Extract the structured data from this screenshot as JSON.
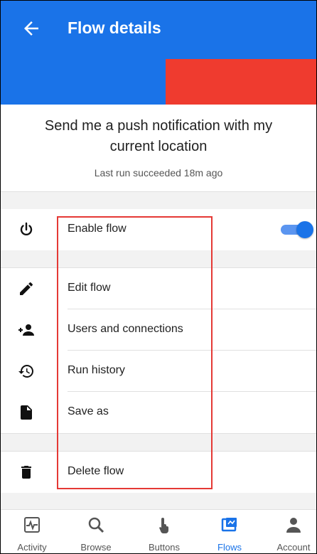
{
  "header": {
    "title": "Flow details",
    "back_icon": "arrow-left-icon"
  },
  "banner": {
    "colors": [
      "#1a73e8",
      "#ef3b2f"
    ]
  },
  "flow": {
    "description": "Send me a push notification with my current location",
    "status": "Last run succeeded 18m ago"
  },
  "actions": {
    "enable": {
      "label": "Enable flow",
      "icon": "power-icon",
      "toggle_on": true
    },
    "edit": {
      "label": "Edit flow",
      "icon": "pencil-icon"
    },
    "users": {
      "label": "Users and connections",
      "icon": "add-person-icon"
    },
    "history": {
      "label": "Run history",
      "icon": "history-icon"
    },
    "save_as": {
      "label": "Save as",
      "icon": "document-icon"
    },
    "delete": {
      "label": "Delete flow",
      "icon": "trash-icon"
    }
  },
  "bottom_nav": [
    {
      "label": "Activity",
      "icon": "activity-icon"
    },
    {
      "label": "Browse",
      "icon": "search-icon"
    },
    {
      "label": "Buttons",
      "icon": "tap-icon"
    },
    {
      "label": "Flows",
      "icon": "flows-icon",
      "active": true
    },
    {
      "label": "Account",
      "icon": "person-icon"
    }
  ],
  "colors": {
    "accent": "#1a73e8",
    "highlight": "#e53935",
    "banner_red": "#ef3b2f"
  }
}
